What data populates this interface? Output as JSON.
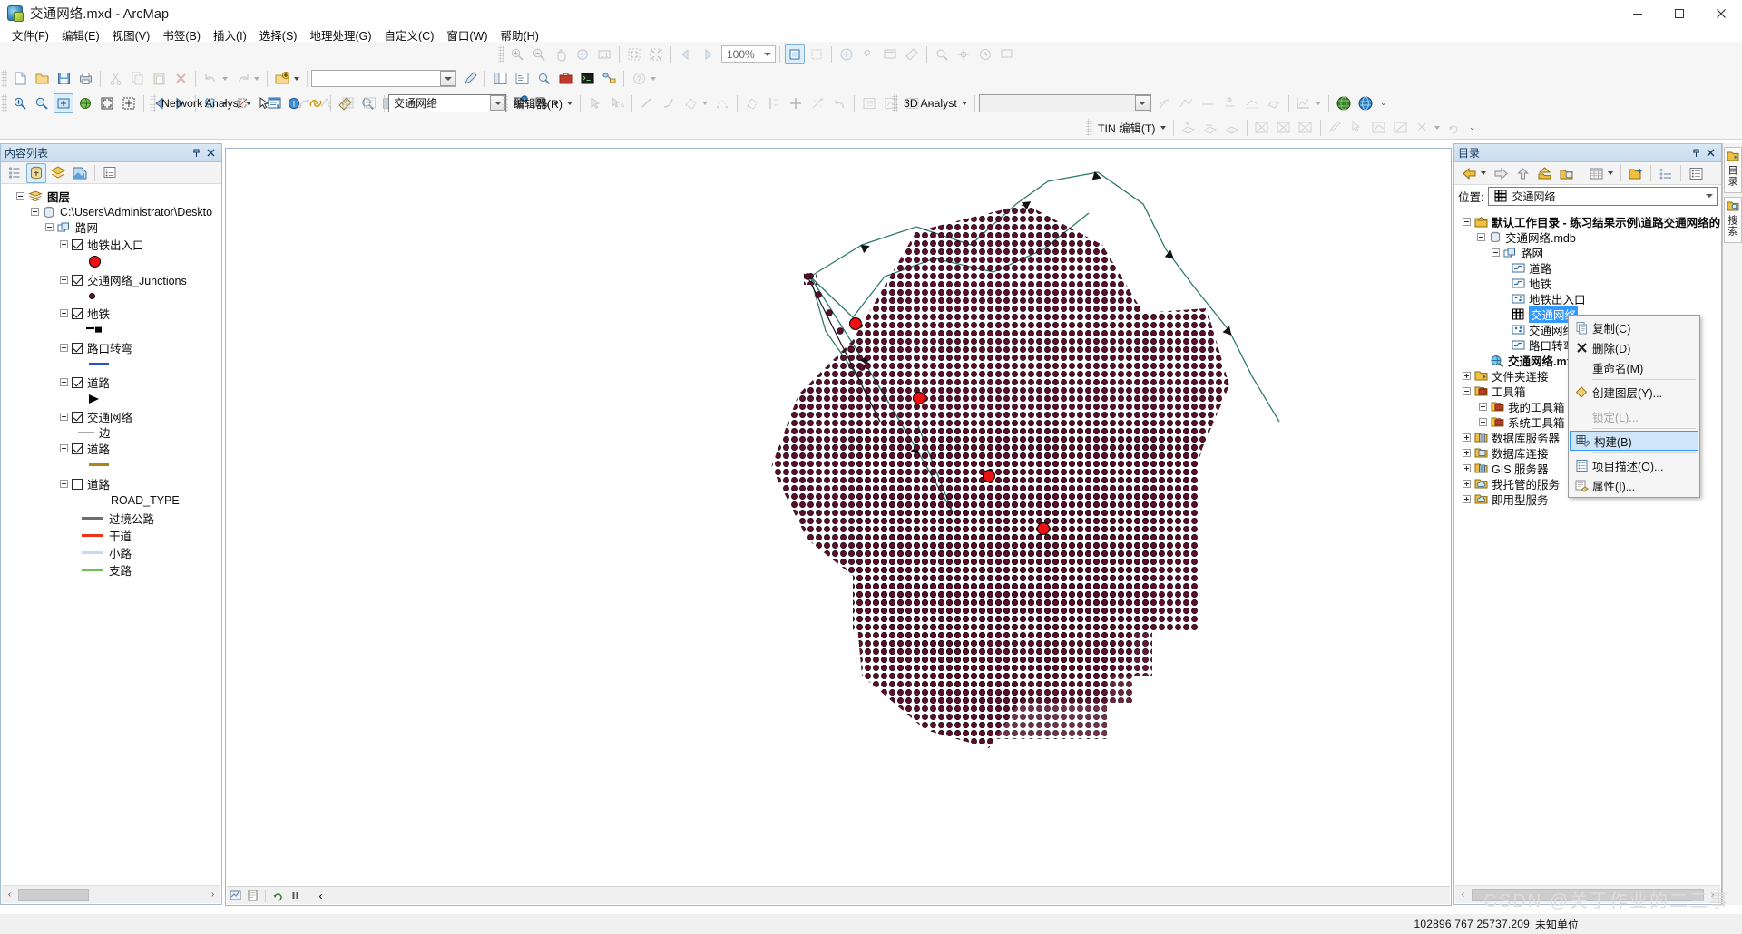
{
  "window": {
    "title": "交通网络.mxd - ArcMap",
    "app_icon": "arcmap-icon",
    "minimize": "–",
    "maximize": "▫",
    "close": "✕"
  },
  "menubar": {
    "items": [
      {
        "label": "文件(F)"
      },
      {
        "label": "编辑(E)"
      },
      {
        "label": "视图(V)"
      },
      {
        "label": "书签(B)"
      },
      {
        "label": "插入(I)"
      },
      {
        "label": "选择(S)"
      },
      {
        "label": "地理处理(G)"
      },
      {
        "label": "自定义(C)"
      },
      {
        "label": "窗口(W)"
      },
      {
        "label": "帮助(H)"
      }
    ]
  },
  "toolbars": {
    "zoom_value": "100%",
    "standard_combo_value": "",
    "network_analyst": {
      "label": "Network Analyst",
      "combo_value": "交通网络"
    },
    "editor": {
      "label": "编辑器(R)"
    },
    "analyst3d": {
      "label": "3D Analyst",
      "combo_value": ""
    },
    "tin_edit": {
      "label": "TIN 编辑(T)"
    }
  },
  "toc": {
    "title": "内容列表",
    "pin_icon": "pin-icon",
    "close_icon": "close-icon",
    "toolbar_icons": [
      "list-by-source-icon",
      "list-by-drawing-order-icon",
      "list-by-visibility-icon",
      "list-by-selection-icon",
      "options-icon"
    ],
    "tree": [
      {
        "label": "图层",
        "indent": 0,
        "type": "group",
        "icon": "layers-icon",
        "expander": "minus"
      },
      {
        "label": "C:\\Users\\Administrator\\Deskto",
        "indent": 1,
        "type": "datasource",
        "icon": "database-icon",
        "expander": "minus"
      },
      {
        "label": "路网",
        "indent": 2,
        "type": "featuredataset",
        "icon": "feature-dataset-icon",
        "expander": "minus"
      },
      {
        "label": "地铁出入口",
        "indent": 3,
        "type": "layer",
        "icon": "point-layer-icon",
        "checked": true,
        "expander": "minus",
        "symbol": {
          "kind": "circle",
          "color": "#ee1111",
          "border": "#000000",
          "size": 11
        }
      },
      {
        "label": "交通网络_Junctions",
        "indent": 3,
        "type": "layer",
        "checked": true,
        "expander": "minus",
        "symbol": {
          "kind": "circle",
          "color": "#6e1033",
          "border": "#000000",
          "size": 7
        }
      },
      {
        "label": "地铁",
        "indent": 3,
        "type": "layer",
        "checked": true,
        "expander": "minus",
        "symbol": {
          "kind": "dash-square",
          "color": "#000000"
        }
      },
      {
        "label": "路口转弯",
        "indent": 3,
        "type": "layer",
        "checked": true,
        "expander": "minus",
        "symbol": {
          "kind": "line",
          "color": "#2b4fd0",
          "width": 3
        }
      },
      {
        "label": "道路",
        "indent": 3,
        "type": "layer",
        "checked": true,
        "expander": "minus",
        "symbol": {
          "kind": "arrow",
          "color": "#000000"
        }
      },
      {
        "label": "交通网络",
        "indent": 3,
        "type": "layer",
        "checked": true,
        "expander": "minus",
        "sublabel": "边",
        "symbol": {
          "kind": "line",
          "color": "#a8a8a8",
          "width": 2
        }
      },
      {
        "label": "道路",
        "indent": 3,
        "type": "layer",
        "checked": true,
        "expander": "minus",
        "symbol": {
          "kind": "line",
          "color": "#b08417",
          "width": 3
        }
      },
      {
        "label": "道路",
        "indent": 3,
        "type": "layer",
        "checked": false,
        "expander": "minus",
        "field": "ROAD_TYPE",
        "classes": [
          {
            "label": "过境公路",
            "color": "#6e6e6e",
            "width": 3
          },
          {
            "label": "干道",
            "color": "#f0341a",
            "width": 3
          },
          {
            "label": "小路",
            "color": "#c6dcf5",
            "width": 3
          },
          {
            "label": "支路",
            "color": "#6fc04e",
            "width": 3
          }
        ]
      }
    ]
  },
  "catalog": {
    "title": "目录",
    "pin_icon": "pin-icon",
    "close_icon": "close-icon",
    "toolbar_icons": [
      "back-icon",
      "forward-icon",
      "up-icon",
      "home-icon",
      "default-geodatabase-icon",
      "list-view-icon",
      "connect-folder-icon",
      "toggle-tree-icon",
      "item-description-icon"
    ],
    "location": {
      "label": "位置:",
      "value": "交通网络",
      "icon": "network-dataset-icon"
    },
    "tree": [
      {
        "label": "默认工作目录 - 练习结果示例\\道路交通网络的构",
        "indent": 0,
        "icon": "home-folder-icon",
        "expander": "minus"
      },
      {
        "label": "交通网络.mdb",
        "indent": 1,
        "icon": "geodatabase-icon",
        "expander": "minus"
      },
      {
        "label": "路网",
        "indent": 2,
        "icon": "feature-dataset-icon",
        "expander": "minus"
      },
      {
        "label": "道路",
        "indent": 3,
        "icon": "line-feature-icon",
        "expander": "none"
      },
      {
        "label": "地铁",
        "indent": 3,
        "icon": "line-feature-icon",
        "expander": "none"
      },
      {
        "label": "地铁出入口",
        "indent": 3,
        "icon": "point-feature-icon",
        "expander": "none"
      },
      {
        "label": "交通网络",
        "indent": 3,
        "icon": "network-dataset-icon",
        "expander": "none",
        "selected": true
      },
      {
        "label": "交通网络_Junctions",
        "indent": 3,
        "icon": "point-feature-icon",
        "expander": "none"
      },
      {
        "label": "路口转弯",
        "indent": 3,
        "icon": "line-feature-icon",
        "expander": "none"
      },
      {
        "label": "交通网络.mxd",
        "indent": 1,
        "icon": "mxd-icon",
        "expander": "none"
      },
      {
        "label": "文件夹连接",
        "indent": 0,
        "icon": "folder-connection-icon",
        "expander": "plus"
      },
      {
        "label": "工具箱",
        "indent": 0,
        "icon": "toolbox-icon",
        "expander": "minus"
      },
      {
        "label": "我的工具箱",
        "indent": 1,
        "icon": "toolbox-icon",
        "expander": "plus"
      },
      {
        "label": "系统工具箱",
        "indent": 1,
        "icon": "toolbox-icon",
        "expander": "plus"
      },
      {
        "label": "数据库服务器",
        "indent": 0,
        "icon": "database-server-icon",
        "expander": "plus"
      },
      {
        "label": "数据库连接",
        "indent": 0,
        "icon": "database-connection-icon",
        "expander": "plus"
      },
      {
        "label": "GIS 服务器",
        "indent": 0,
        "icon": "gis-server-icon",
        "expander": "plus"
      },
      {
        "label": "我托管的服务",
        "indent": 0,
        "icon": "hosted-services-icon",
        "expander": "plus"
      },
      {
        "label": "即用型服务",
        "indent": 0,
        "icon": "ready-to-use-icon",
        "expander": "plus"
      }
    ]
  },
  "context_menu": {
    "items": [
      {
        "label": "复制(C)",
        "icon": "copy-icon",
        "state": "normal"
      },
      {
        "label": "删除(D)",
        "icon": "delete-icon",
        "state": "normal"
      },
      {
        "label": "重命名(M)",
        "icon": "",
        "state": "normal"
      },
      {
        "label": "创建图层(Y)...",
        "icon": "create-layer-icon",
        "state": "normal"
      },
      {
        "label": "锁定(L)...",
        "icon": "",
        "state": "disabled"
      },
      {
        "label": "构建(B)",
        "icon": "build-icon",
        "state": "highlighted"
      },
      {
        "label": "项目描述(O)...",
        "icon": "item-description-icon",
        "state": "normal"
      },
      {
        "label": "属性(I)...",
        "icon": "properties-icon",
        "state": "normal"
      }
    ]
  },
  "vtabs": [
    {
      "label": "目录",
      "icon": "catalog-icon"
    },
    {
      "label": "搜索",
      "icon": "search-icon"
    }
  ],
  "statusbar": {
    "coords": "102896.767  25737.209",
    "units": "未知单位"
  },
  "watermark": "CSDN @关于作业的二三事",
  "map": {
    "background": "#ffffff",
    "node_color": "#5c0e2c",
    "node_border": "#000000",
    "highlight_node_color": "#ee1111",
    "edge_color": "#2f7a6e"
  }
}
